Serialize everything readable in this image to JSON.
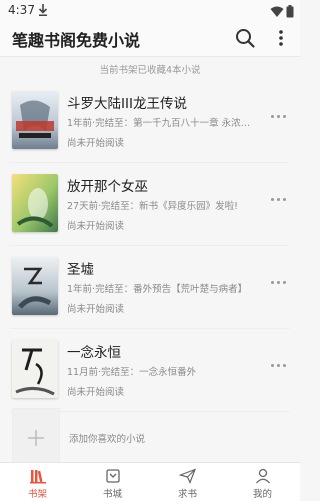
{
  "status_bar": {
    "time": "4:37"
  },
  "app_bar": {
    "title": "笔趣书阁免费小说"
  },
  "notice": "当前书架已收藏4本小说",
  "books": [
    {
      "title": "斗罗大陆III龙王传说",
      "meta": "1年前·完结至：第一千九百八十一章 永浓…",
      "status": "尚未开始阅读"
    },
    {
      "title": "放开那个女巫",
      "meta": "27天前·完结至：新书《异度乐园》发啦!",
      "status": "尚未开始阅读"
    },
    {
      "title": "圣墟",
      "meta": "1年前·完结至：番外预告【荒叶楚与病者】",
      "status": "尚未开始阅读"
    },
    {
      "title": "一念永恒",
      "meta": "11月前·完结至：一念永恒番外",
      "status": "尚未开始阅读"
    }
  ],
  "add_book_label": "添加你喜欢的小说",
  "bottom_nav": [
    {
      "label": "书架",
      "icon": "bookshelf-icon",
      "active": true
    },
    {
      "label": "书城",
      "icon": "bookstore-icon",
      "active": false
    },
    {
      "label": "求书",
      "icon": "send-icon",
      "active": false
    },
    {
      "label": "我的",
      "icon": "profile-icon",
      "active": false
    }
  ],
  "colors": {
    "accent": "#e8543c",
    "text": "#222222",
    "muted": "#8a8a8a"
  },
  "icons": [
    "download-icon",
    "wifi-icon",
    "battery-icon",
    "search-icon",
    "more-vertical-icon",
    "more-horizontal-icon",
    "add-icon"
  ]
}
